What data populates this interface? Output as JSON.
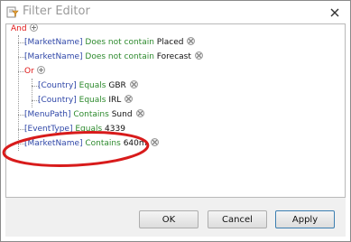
{
  "window": {
    "title": "Filter Editor",
    "title_icon": "filter-editor-icon",
    "close_icon": "close-icon"
  },
  "tree": {
    "root": {
      "label": "And",
      "add_icon": "add-condition-icon"
    },
    "conditions": [
      {
        "field": "[MarketName]",
        "operator": "Does not contain",
        "value": "Placed"
      },
      {
        "field": "[MarketName]",
        "operator": "Does not contain",
        "value": "Forecast"
      }
    ],
    "group": {
      "label": "Or",
      "conditions": [
        {
          "field": "[Country]",
          "operator": "Equals",
          "value": "GBR"
        },
        {
          "field": "[Country]",
          "operator": "Equals",
          "value": "IRL"
        }
      ]
    },
    "after": [
      {
        "field": "[MenuPath]",
        "operator": "Contains",
        "value": "Sund"
      },
      {
        "field": "[EventType]",
        "operator": "Equals",
        "value": "4339"
      },
      {
        "field": "[MarketName]",
        "operator": "Contains",
        "value": "640m"
      }
    ]
  },
  "buttons": {
    "ok": "OK",
    "cancel": "Cancel",
    "apply": "Apply"
  },
  "annotation": {
    "shape": "ellipse",
    "color": "#d81b1b"
  }
}
